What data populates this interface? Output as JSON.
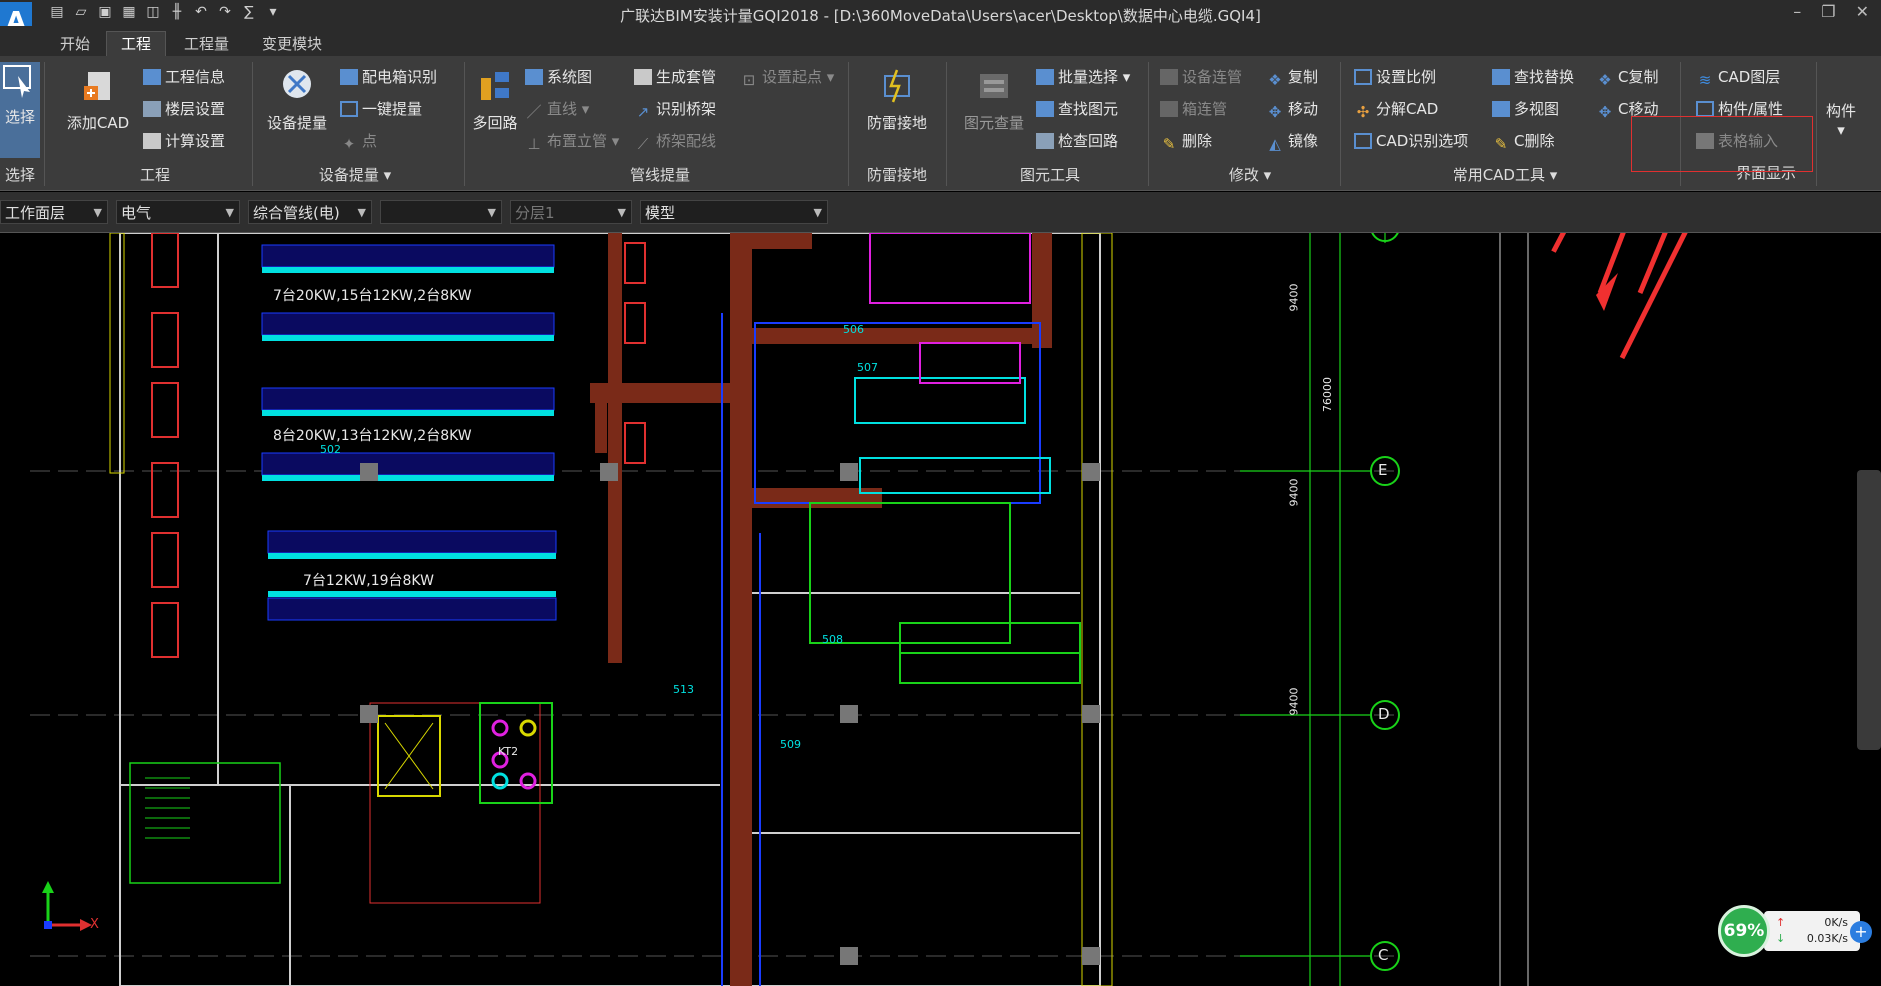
{
  "window": {
    "app_logo": "A",
    "title": "广联达BIM安装计量GQI2018 - [D:\\360MoveData\\Users\\acer\\Desktop\\数据中心电缆.GQI4]"
  },
  "tabs": [
    "开始",
    "工程",
    "工程量",
    "变更模块"
  ],
  "active_tab": "工程",
  "ribbon": {
    "select": {
      "label": "选择",
      "group": "选择"
    },
    "project": {
      "add_cad": "添加CAD",
      "info": "工程信息",
      "floor": "楼层设置",
      "calc": "计算设置",
      "group": "工程"
    },
    "device": {
      "extract": "设备提量",
      "panel": "配电箱识别",
      "one_click": "一键提量",
      "point": "点",
      "group": "设备提量"
    },
    "pipe": {
      "multi_loop": "多回路",
      "system_diagram": "系统图",
      "straight": "直线",
      "riser": "布置立管",
      "gen_sleeve": "生成套管",
      "set_start": "设置起点",
      "tray_id": "识别桥架",
      "tray_wire": "桥架配线",
      "group": "管线提量"
    },
    "lightning": {
      "grounding": "防雷接地",
      "group": "防雷接地"
    },
    "element": {
      "view": "图元查量",
      "batch_select": "批量选择",
      "find": "查找图元",
      "check_loop": "检查回路",
      "group": "图元工具"
    },
    "modify": {
      "dev_connect": "设备连管",
      "box_connect": "箱连管",
      "delete": "删除",
      "copy": "复制",
      "move": "移动",
      "mirror": "镜像",
      "group": "修改"
    },
    "cad_tools": {
      "set_ratio": "设置比例",
      "explode": "分解CAD",
      "cad_options": "CAD识别选项",
      "find_replace": "查找替换",
      "multi_view": "多视图",
      "c_delete": "C删除",
      "c_copy": "C复制",
      "c_move": "C移动",
      "group": "常用CAD工具"
    },
    "ui": {
      "cad_layer": "CAD图层",
      "component_attr": "构件/属性",
      "table_input": "表格输入",
      "ui_display": "界面显示"
    },
    "component": {
      "label": "构件"
    }
  },
  "toolbar2": {
    "layer": "工作面层",
    "discipline": "电气",
    "type": "综合管线(电)",
    "blank": "",
    "sublayer": "分层1",
    "mode": "模型"
  },
  "drawing": {
    "room_502": "502",
    "room_506": "506",
    "room_507": "507",
    "room_508": "508",
    "room_509": "509",
    "room_513": "513",
    "rack_text_1": "7台20KW,15台12KW,2台8KW",
    "rack_text_2": "8台20KW,13台12KW,2台8KW",
    "rack_text_3": "7台12KW,19台8KW",
    "axis_E": "E",
    "axis_D": "D",
    "axis_C": "C",
    "dim_9400a": "9400",
    "dim_76000": "76000",
    "dim_9400b": "9400",
    "dim_9400c": "9400",
    "ucs_x": "X",
    "kt2": "KT2"
  },
  "net_widget": {
    "percent": "69%",
    "up": "0K/s",
    "down": "0.03K/s"
  },
  "colors": {
    "wall_brown": "#7a2a18",
    "cyan": "#00e0e0",
    "blue": "#1a3cff",
    "green": "#19d219",
    "magenta": "#e020e0",
    "yellow": "#d8d800",
    "red_arrow": "#f03030"
  }
}
